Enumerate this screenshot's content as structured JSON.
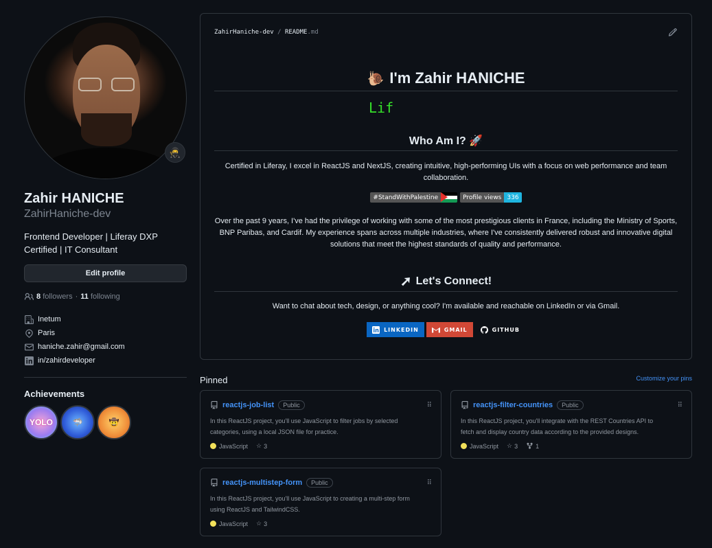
{
  "profile": {
    "name": "Zahir HANICHE",
    "login": "ZahirHaniche-dev",
    "bio": "Frontend Developer | Liferay DXP Certified | IT Consultant",
    "edit_label": "Edit profile",
    "followers_count": "8",
    "followers_label": "followers",
    "following_count": "11",
    "following_label": "following",
    "separator": "·",
    "company": "Inetum",
    "location": "Paris",
    "email": "haniche.zahir@gmail.com",
    "linkedin": "in/zahirdeveloper",
    "status_icon": "ninja-emoji-icon"
  },
  "achievements": {
    "title": "Achievements",
    "badges": [
      {
        "name": "yolo",
        "label": "YOLO"
      },
      {
        "name": "pull-shark",
        "label": ""
      },
      {
        "name": "starstruck",
        "label": ""
      }
    ]
  },
  "readme": {
    "owner": "ZahirHaniche-dev",
    "slash": "/",
    "file": "README",
    "ext": ".md",
    "heading": "I'm Zahir HANICHE",
    "typing_text": "Lif",
    "who_title": "Who Am I? 🚀",
    "who_text": "Certified in Liferay, I excel in ReactJS and NextJS, creating intuitive, high-performing UIs with a focus on web performance and team collaboration.",
    "shield_stand": "#StandWithPalestine",
    "shield_views_label": "Profile views",
    "shield_views_count": "336",
    "experience_text": "Over the past 9 years, I've had the privilege of working with some of the most prestigious clients in France, including the Ministry of Sports, BNP Paribas, and Cardif. My experience spans across multiple industries, where I've consistently delivered robust and innovative digital solutions that meet the highest standards of quality and performance.",
    "connect_title": "Let's Connect!",
    "connect_text": "Want to chat about tech, design, or anything cool? I'm available and reachable on LinkedIn or via Gmail.",
    "linkedin_btn": "LINKEDIN",
    "gmail_btn": "GMAIL",
    "github_btn": "GITHUB"
  },
  "pinned": {
    "title": "Pinned",
    "customize": "Customize your pins",
    "repos": [
      {
        "name": "reactjs-job-list",
        "visibility": "Public",
        "desc": "In this ReactJS project, you'll use JavaScript to filter jobs by selected categories, using a local JSON file for practice.",
        "lang": "JavaScript",
        "stars": "3",
        "forks": ""
      },
      {
        "name": "reactjs-filter-countries",
        "visibility": "Public",
        "desc": "In this ReactJS project, you'll integrate with the REST Countries API to fetch and display country data according to the provided designs.",
        "lang": "JavaScript",
        "stars": "3",
        "forks": "1"
      },
      {
        "name": "reactjs-multistep-form",
        "visibility": "Public",
        "desc": "In this ReactJS project, you'll use JavaScript to creating a multi-step form using ReactJS and TailwindCSS.",
        "lang": "JavaScript",
        "stars": "3",
        "forks": ""
      }
    ]
  },
  "colors": {
    "bg": "#0d1117",
    "border": "#30363d",
    "link": "#4493f8",
    "typing": "#36e22a",
    "js": "#f1e05a",
    "linkedin": "#0a66c2",
    "gmail": "#d14836"
  }
}
